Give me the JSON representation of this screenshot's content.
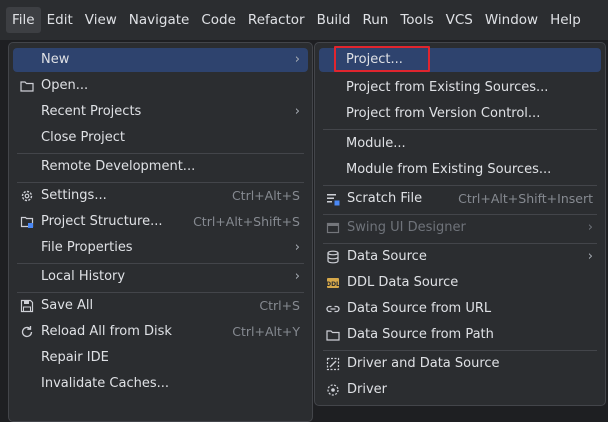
{
  "menubar": {
    "items": [
      "File",
      "Edit",
      "View",
      "Navigate",
      "Code",
      "Refactor",
      "Build",
      "Run",
      "Tools",
      "VCS",
      "Window",
      "Help"
    ]
  },
  "file_menu": {
    "new": "New",
    "open": "Open...",
    "recent_projects": "Recent Projects",
    "close_project": "Close Project",
    "remote_development": "Remote Development...",
    "settings": "Settings...",
    "settings_shortcut": "Ctrl+Alt+S",
    "project_structure": "Project Structure...",
    "project_structure_shortcut": "Ctrl+Alt+Shift+S",
    "file_properties": "File Properties",
    "local_history": "Local History",
    "save_all": "Save All",
    "save_all_shortcut": "Ctrl+S",
    "reload_all": "Reload All from Disk",
    "reload_all_shortcut": "Ctrl+Alt+Y",
    "repair_ide": "Repair IDE",
    "invalidate_caches": "Invalidate Caches..."
  },
  "new_submenu": {
    "project": "Project...",
    "project_existing": "Project from Existing Sources...",
    "project_vcs": "Project from Version Control...",
    "module": "Module...",
    "module_existing": "Module from Existing Sources...",
    "scratch_file": "Scratch File",
    "scratch_file_shortcut": "Ctrl+Alt+Shift+Insert",
    "swing_ui_designer": "Swing UI Designer",
    "data_source": "Data Source",
    "ddl_data_source": "DDL Data Source",
    "data_source_url": "Data Source from URL",
    "data_source_path": "Data Source from Path",
    "driver_and_data_source": "Driver and Data Source",
    "driver": "Driver"
  },
  "colors": {
    "background": "#1e1f22",
    "menu_background": "#2b2d30",
    "selection": "#2e436e",
    "highlight_box": "#e0252e"
  }
}
